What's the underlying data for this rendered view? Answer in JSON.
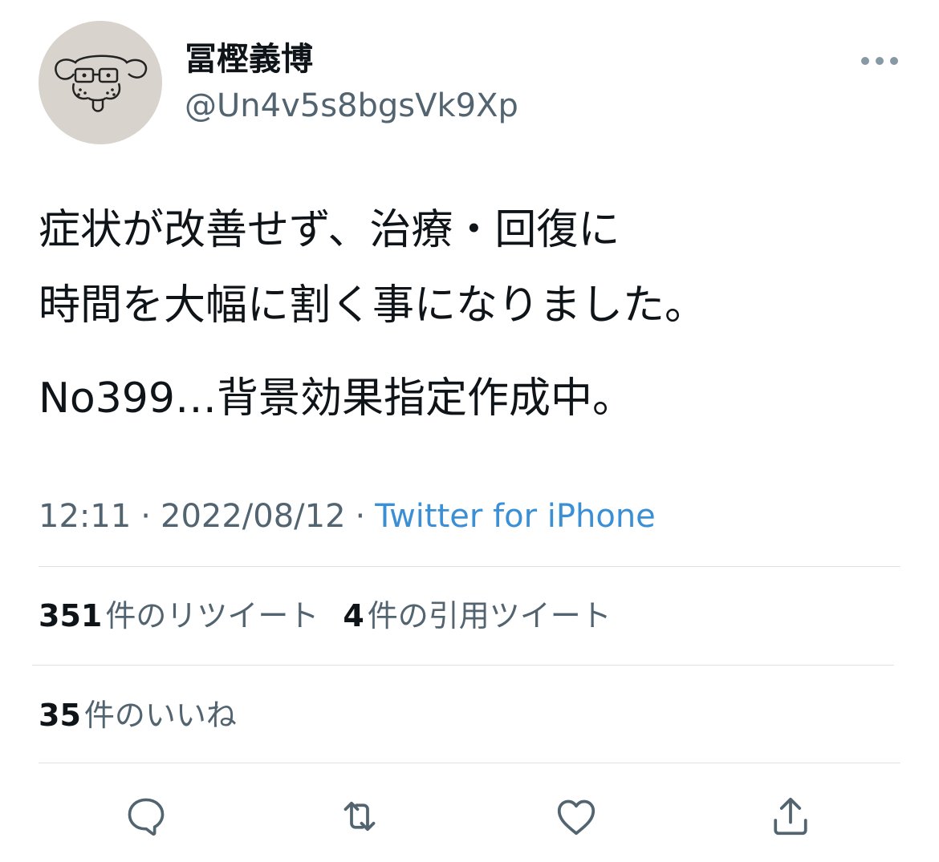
{
  "user": {
    "display_name": "冨樫義博",
    "handle": "@Un4v5s8bgsVk9Xp",
    "avatar_icon": "avatar-drawing-icon"
  },
  "tweet": {
    "lines": [
      "症状が改善せず、治療・回復に",
      "時間を大幅に割く事になりました。",
      "No399…背景効果指定作成中。"
    ]
  },
  "meta": {
    "time": "12:11",
    "separator": "·",
    "date": "2022/08/12",
    "source": "Twitter for iPhone"
  },
  "stats": {
    "retweets": {
      "count": "351",
      "label": "件のリツイート"
    },
    "quotes": {
      "count": "4",
      "label": "件の引用ツイート"
    },
    "likes": {
      "count": "35",
      "label": "件のいいね"
    }
  },
  "actions": {
    "reply": "reply-icon",
    "retweet": "retweet-icon",
    "like": "heart-icon",
    "share": "share-icon"
  },
  "colors": {
    "text": "#0f1419",
    "secondary": "#536471",
    "link": "#3b8fd4",
    "divider": "#dfe3e6"
  }
}
